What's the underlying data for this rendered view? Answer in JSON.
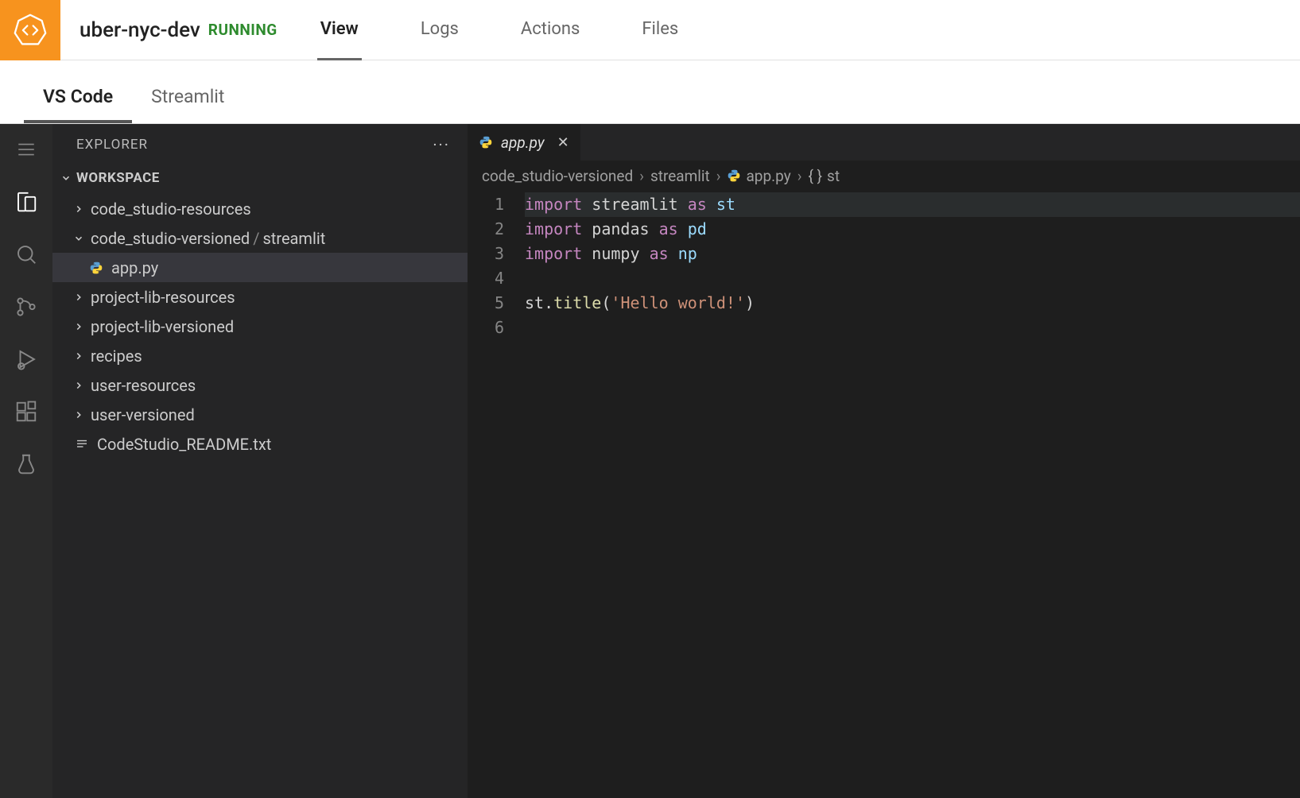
{
  "header": {
    "project_title": "uber-nyc-dev",
    "status": "RUNNING",
    "tabs": [
      "View",
      "Logs",
      "Actions",
      "Files"
    ],
    "active_tab_index": 0
  },
  "sub_tabs": {
    "items": [
      "VS Code",
      "Streamlit"
    ],
    "active_index": 0
  },
  "explorer": {
    "title": "EXPLORER",
    "workspace_label": "WORKSPACE",
    "tree": [
      {
        "type": "folder",
        "label": "code_studio-resources",
        "expanded": false,
        "depth": 1
      },
      {
        "type": "folder-path",
        "label_a": "code_studio-versioned",
        "label_b": "streamlit",
        "expanded": true,
        "depth": 1
      },
      {
        "type": "file-py",
        "label": "app.py",
        "selected": true,
        "depth": 2
      },
      {
        "type": "folder",
        "label": "project-lib-resources",
        "expanded": false,
        "depth": 1
      },
      {
        "type": "folder",
        "label": "project-lib-versioned",
        "expanded": false,
        "depth": 1
      },
      {
        "type": "folder",
        "label": "recipes",
        "expanded": false,
        "depth": 1
      },
      {
        "type": "folder",
        "label": "user-resources",
        "expanded": false,
        "depth": 1
      },
      {
        "type": "folder",
        "label": "user-versioned",
        "expanded": false,
        "depth": 1
      },
      {
        "type": "file-txt",
        "label": "CodeStudio_README.txt",
        "depth": 1
      }
    ]
  },
  "editor": {
    "tab": {
      "filename": "app.py"
    },
    "breadcrumbs": [
      "code_studio-versioned",
      "streamlit",
      "app.py",
      "st"
    ],
    "code": {
      "line_count": 6,
      "lines": [
        {
          "kw": "import",
          "mod": "streamlit",
          "as": "as",
          "alias": "st"
        },
        {
          "kw": "import",
          "mod": "pandas",
          "as": "as",
          "alias": "pd"
        },
        {
          "kw": "import",
          "mod": "numpy",
          "as": "as",
          "alias": "np"
        },
        {
          "blank": true
        },
        {
          "obj": "st",
          "fn": "title",
          "str": "'Hello world!'"
        },
        {
          "blank": true
        }
      ]
    }
  }
}
